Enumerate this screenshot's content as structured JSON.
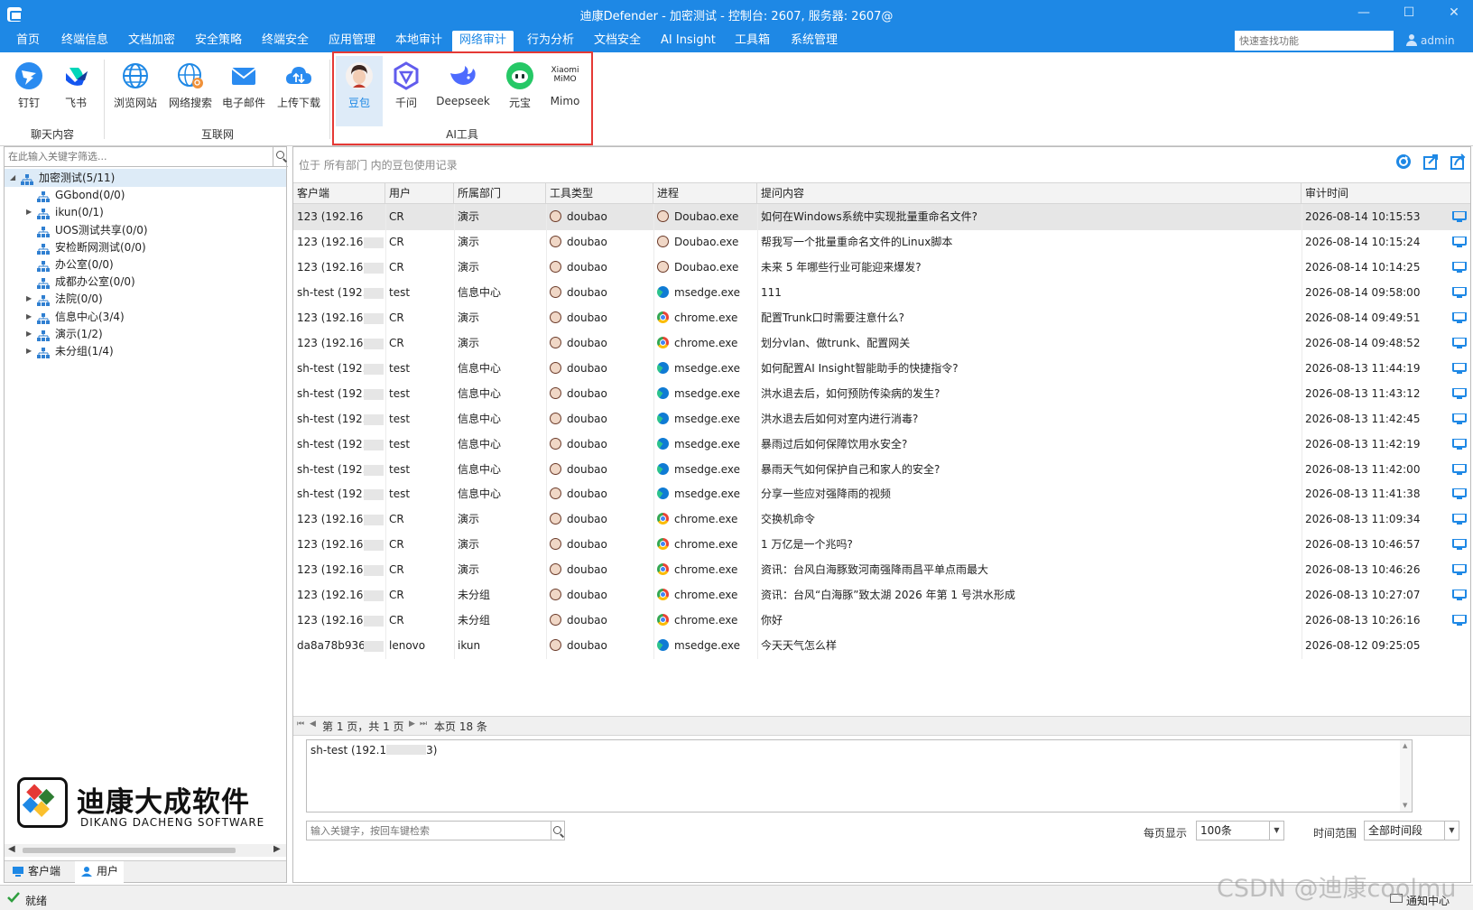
{
  "window": {
    "title": "迪康Defender - 加密测试 - 控制台: 2607, 服务器: 2607@"
  },
  "menu": {
    "items": [
      "首页",
      "终端信息",
      "文档加密",
      "安全策略",
      "终端安全",
      "应用管理",
      "本地审计",
      "网络审计",
      "行为分析",
      "文档安全",
      "AI Insight",
      "工具箱",
      "系统管理"
    ],
    "active": "网络审计",
    "quick_search_placeholder": "快速查找功能",
    "user": "admin"
  },
  "ribbon": {
    "groups": [
      {
        "label": "聊天内容",
        "buttons": [
          "钉钉",
          "飞书"
        ]
      },
      {
        "label": "互联网",
        "buttons": [
          "浏览网站",
          "网络搜索",
          "电子邮件",
          "上传下载"
        ]
      },
      {
        "label": "AI工具",
        "buttons": [
          "豆包",
          "千问",
          "Deepseek",
          "元宝",
          "Mimo"
        ]
      }
    ],
    "active_button": "豆包",
    "mimo_logo_text": [
      "Xiaomi",
      "MiMO"
    ]
  },
  "sidebar": {
    "filter_placeholder": "在此输入关键字筛选...",
    "tree": [
      {
        "label": "加密测试(5/11)",
        "level": 0,
        "expanded": true,
        "selected": true
      },
      {
        "label": "GGbond(0/0)",
        "level": 1,
        "expandable": false
      },
      {
        "label": "ikun(0/1)",
        "level": 1,
        "expandable": true
      },
      {
        "label": "UOS测试共享(0/0)",
        "level": 1,
        "expandable": false
      },
      {
        "label": "安检断网测试(0/0)",
        "level": 1,
        "expandable": false
      },
      {
        "label": "办公室(0/0)",
        "level": 1,
        "expandable": false
      },
      {
        "label": "成都办公室(0/0)",
        "level": 1,
        "expandable": false
      },
      {
        "label": "法院(0/0)",
        "level": 1,
        "expandable": true
      },
      {
        "label": "信息中心(3/4)",
        "level": 1,
        "expandable": true
      },
      {
        "label": "演示(1/2)",
        "level": 1,
        "expandable": true
      },
      {
        "label": "未分组(1/4)",
        "level": 1,
        "expandable": true
      }
    ],
    "logo": {
      "name": "迪康大成软件",
      "subtitle": "DIKANG DACHENG SOFTWARE"
    },
    "tabs": [
      "客户端",
      "用户"
    ],
    "active_tab": "用户"
  },
  "main": {
    "location": "位于 所有部门 内的豆包使用记录",
    "columns": [
      "客户端",
      "用户",
      "所属部门",
      "工具类型",
      "进程",
      "提问内容",
      "审计时间"
    ],
    "rows": [
      {
        "client": "123 (192.168.",
        "user": "CR",
        "dept": "演示",
        "tool": "doubao",
        "process": "Doubao.exe",
        "picon": "doubao",
        "question": "如何在Windows系统中实现批量重命名文件?",
        "time": "2026-08-14 10:15:53",
        "selected": true
      },
      {
        "client": "123 (192.168.",
        "user": "CR",
        "dept": "演示",
        "tool": "doubao",
        "process": "Doubao.exe",
        "picon": "doubao",
        "question": "帮我写一个批量重命名文件的Linux脚本",
        "time": "2026-08-14 10:15:24"
      },
      {
        "client": "123 (192.168.",
        "user": "CR",
        "dept": "演示",
        "tool": "doubao",
        "process": "Doubao.exe",
        "picon": "doubao",
        "question": "未来 5 年哪些行业可能迎来爆发?",
        "time": "2026-08-14 10:14:25"
      },
      {
        "client": "sh-test (192.1",
        "user": "test",
        "dept": "信息中心",
        "tool": "doubao",
        "process": "msedge.exe",
        "picon": "edge",
        "question": "111",
        "time": "2026-08-14 09:58:00"
      },
      {
        "client": "123 (192.168.",
        "user": "CR",
        "dept": "演示",
        "tool": "doubao",
        "process": "chrome.exe",
        "picon": "chrome",
        "question": "配置Trunk口时需要注意什么?",
        "time": "2026-08-14 09:49:51"
      },
      {
        "client": "123 (192.168.",
        "user": "CR",
        "dept": "演示",
        "tool": "doubao",
        "process": "chrome.exe",
        "picon": "chrome",
        "question": "划分vlan、做trunk、配置网关",
        "time": "2026-08-14 09:48:52"
      },
      {
        "client": "sh-test (192.1",
        "user": "test",
        "dept": "信息中心",
        "tool": "doubao",
        "process": "msedge.exe",
        "picon": "edge",
        "question": "如何配置AI Insight智能助手的快捷指令?",
        "time": "2026-08-13 11:44:19"
      },
      {
        "client": "sh-test (192.1",
        "user": "test",
        "dept": "信息中心",
        "tool": "doubao",
        "process": "msedge.exe",
        "picon": "edge",
        "question": "洪水退去后，如何预防传染病的发生?",
        "time": "2026-08-13 11:43:12"
      },
      {
        "client": "sh-test (192.1",
        "user": "test",
        "dept": "信息中心",
        "tool": "doubao",
        "process": "msedge.exe",
        "picon": "edge",
        "question": "洪水退去后如何对室内进行消毒?",
        "time": "2026-08-13 11:42:45"
      },
      {
        "client": "sh-test (192.1",
        "user": "test",
        "dept": "信息中心",
        "tool": "doubao",
        "process": "msedge.exe",
        "picon": "edge",
        "question": "暴雨过后如何保障饮用水安全?",
        "time": "2026-08-13 11:42:19"
      },
      {
        "client": "sh-test (192.1",
        "user": "test",
        "dept": "信息中心",
        "tool": "doubao",
        "process": "msedge.exe",
        "picon": "edge",
        "question": "暴雨天气如何保护自己和家人的安全?",
        "time": "2026-08-13 11:42:00"
      },
      {
        "client": "sh-test (192.1",
        "user": "test",
        "dept": "信息中心",
        "tool": "doubao",
        "process": "msedge.exe",
        "picon": "edge",
        "question": "分享一些应对强降雨的视频",
        "time": "2026-08-13 11:41:38"
      },
      {
        "client": "123 (192.168.",
        "user": "CR",
        "dept": "演示",
        "tool": "doubao",
        "process": "chrome.exe",
        "picon": "chrome",
        "question": "交换机命令",
        "time": "2026-08-13 11:09:34"
      },
      {
        "client": "123 (192.168.",
        "user": "CR",
        "dept": "演示",
        "tool": "doubao",
        "process": "chrome.exe",
        "picon": "chrome",
        "question": "1 万亿是一个兆吗?",
        "time": "2026-08-13 10:46:57"
      },
      {
        "client": "123 (192.168.",
        "user": "CR",
        "dept": "演示",
        "tool": "doubao",
        "process": "chrome.exe",
        "picon": "chrome",
        "question": "资讯：台风白海豚致河南强降雨昌平单点雨最大",
        "time": "2026-08-13 10:46:26"
      },
      {
        "client": "123 (192.168.",
        "user": "CR",
        "dept": "未分组",
        "tool": "doubao",
        "process": "chrome.exe",
        "picon": "chrome",
        "question": "资讯：台风“白海豚”致太湖 2026 年第 1 号洪水形成",
        "time": "2026-08-13 10:27:07"
      },
      {
        "client": "123 (192.168.",
        "user": "CR",
        "dept": "未分组",
        "tool": "doubao",
        "process": "chrome.exe",
        "picon": "chrome",
        "question": "你好",
        "time": "2026-08-13 10:26:16"
      },
      {
        "client": "da8a78b9365",
        "user": "lenovo",
        "dept": "ikun",
        "tool": "doubao",
        "process": "msedge.exe",
        "picon": "edge",
        "question": "今天天气怎么样",
        "time": "2026-08-12 09:25:05",
        "no_screen": true
      }
    ],
    "pager": {
      "page": "第 1 页，共 1 页",
      "count": "本页 18 条"
    },
    "detail_text_prefix": "sh-test (192.1",
    "detail_text_suffix": "3)",
    "keyword_placeholder": "输入关键字，按回车键检索",
    "per_page_label": "每页显示",
    "per_page_value": "100条",
    "time_range_label": "时间范围",
    "time_range_value": "全部时间段"
  },
  "status": {
    "text": "就绪",
    "notify": "通知中心"
  },
  "watermark": "CSDN @迪康coolmu",
  "colors": {
    "accent": "#1e88e5",
    "highlight_box": "#e53935",
    "selected_row": "#e6e6e6"
  }
}
